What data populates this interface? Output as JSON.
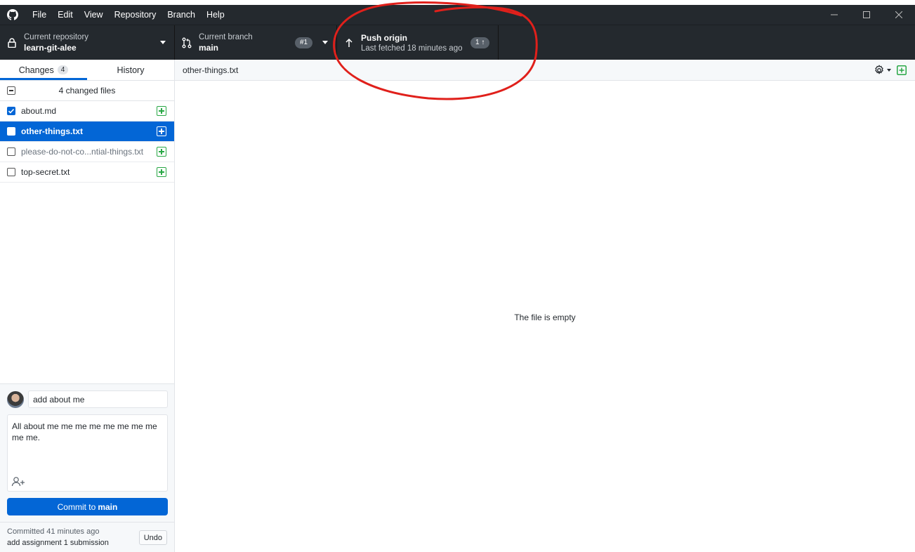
{
  "menu": {
    "items": [
      "File",
      "Edit",
      "View",
      "Repository",
      "Branch",
      "Help"
    ]
  },
  "toolbar": {
    "repo_label": "Current repository",
    "repo_value": "learn-git-alee",
    "branch_label": "Current branch",
    "branch_value": "main",
    "pr_badge": "#1",
    "push_title": "Push origin",
    "push_subtitle": "Last fetched 18 minutes ago",
    "push_badge": "1 ↑"
  },
  "sidebar": {
    "tabs": [
      {
        "label": "Changes",
        "count": "4",
        "active": true
      },
      {
        "label": "History",
        "active": false
      }
    ],
    "changes_header": "4 changed files",
    "files": [
      {
        "name": "about.md",
        "checked": true,
        "selected": false
      },
      {
        "name": "other-things.txt",
        "checked": false,
        "selected": true
      },
      {
        "name": "please-do-not-co...ntial-things.txt",
        "checked": false,
        "selected": false
      },
      {
        "name": "top-secret.txt",
        "checked": false,
        "selected": false
      }
    ]
  },
  "commit": {
    "summary": "add about me",
    "description": "All about me me me me me me me me me me.",
    "button_prefix": "Commit to",
    "button_branch": "main"
  },
  "last_commit": {
    "time": "Committed 41 minutes ago",
    "message": "add assignment 1 submission",
    "undo_label": "Undo"
  },
  "diff": {
    "path": "other-things.txt",
    "empty_message": "The file is empty"
  },
  "colors": {
    "accent": "#0366d6",
    "toolbar_bg": "#24292e",
    "added": "#28a745",
    "annotation": "#e0201b"
  }
}
